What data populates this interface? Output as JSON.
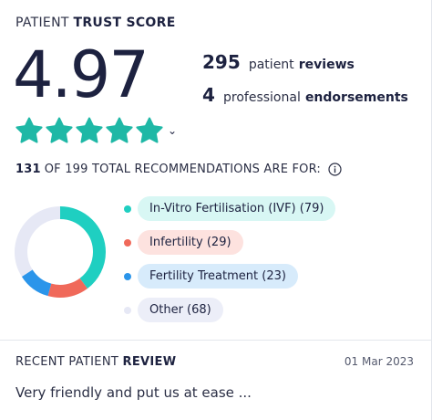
{
  "trust": {
    "title_prefix": "PATIENT",
    "title_emphasis": "TRUST SCORE",
    "score": "4.97",
    "stars": 5,
    "star_color": "#1fb8a6"
  },
  "stats": {
    "reviews_count": "295",
    "reviews_text": "patient",
    "reviews_emphasis": "reviews",
    "endorsements_count": "4",
    "endorsements_text": "professional",
    "endorsements_emphasis": "endorsements"
  },
  "recommendations": {
    "count": "131",
    "text": "OF 199 TOTAL RECOMMENDATIONS ARE FOR:",
    "items": [
      {
        "label": "In-Vitro Fertilisation (IVF) (79)",
        "value": 79,
        "color": "#1fcfc1",
        "pill_bg": "#d8f7f4"
      },
      {
        "label": "Infertility (29)",
        "value": 29,
        "color": "#f0695a",
        "pill_bg": "#fde2df"
      },
      {
        "label": "Fertility Treatment (23)",
        "value": 23,
        "color": "#2b95ea",
        "pill_bg": "#d7ebfb"
      },
      {
        "label": "Other (68)",
        "value": 68,
        "color": "#e6e8f5",
        "pill_bg": "#eceef8"
      }
    ]
  },
  "review": {
    "title_prefix": "RECENT PATIENT",
    "title_emphasis": "REVIEW",
    "date": "01 Mar 2023",
    "text": "Very friendly and put us at ease ..."
  }
}
